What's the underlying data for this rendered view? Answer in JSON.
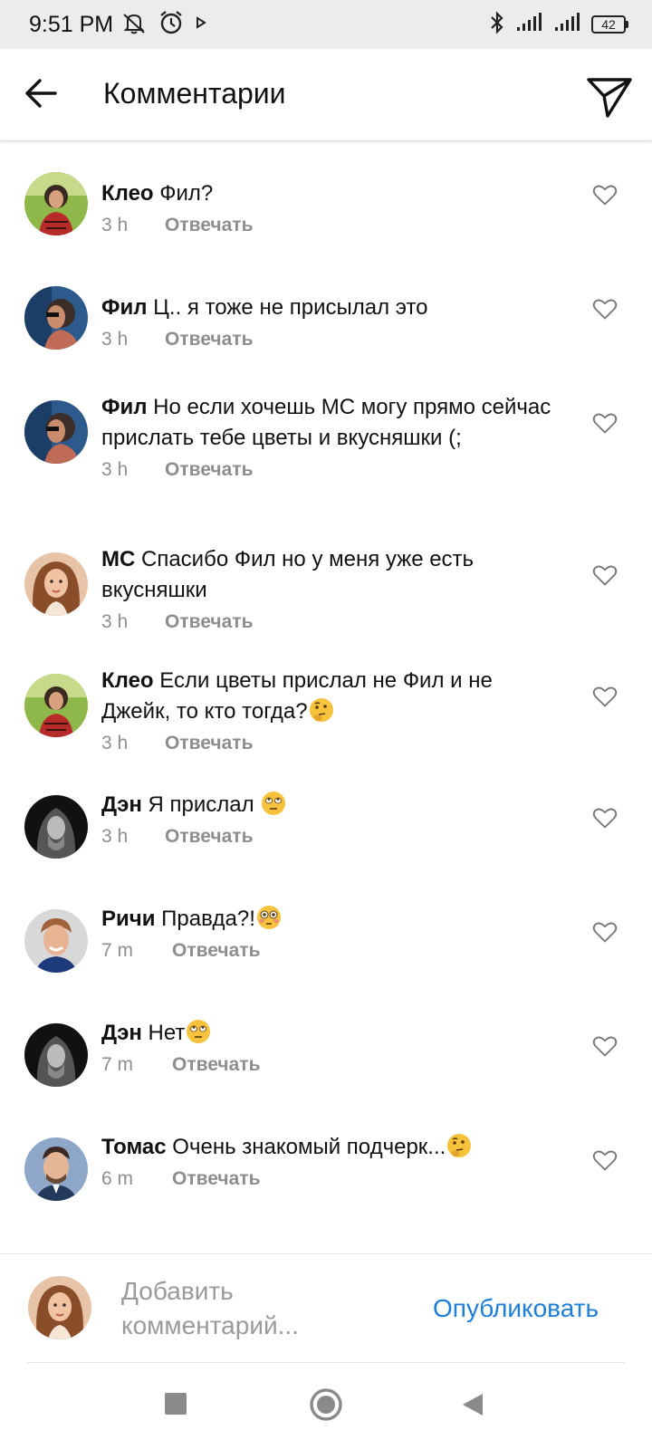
{
  "status_bar": {
    "time": "9:51 PM",
    "left_icons": [
      "mute-icon",
      "alarm-icon",
      "play-icon"
    ],
    "right_icons": [
      "bluetooth-icon",
      "signal-icon",
      "signal-icon"
    ],
    "battery": "42"
  },
  "header": {
    "title": "Комментарии",
    "back_icon": "arrow-left-icon",
    "send_icon": "paper-plane-icon"
  },
  "comments": [
    {
      "author": "Клео",
      "text": "Фил?",
      "emoji": null,
      "time": "3 h",
      "reply": "Отвечать",
      "avatar": "cleo"
    },
    {
      "author": "Фил",
      "text": "Ц.. я тоже не присылал это",
      "emoji": null,
      "time": "3 h",
      "reply": "Отвечать",
      "avatar": "phil"
    },
    {
      "author": "Фил",
      "text": "Но если хочешь МС могу прямо сейчас прислать тебе цветы и вкусняшки (;",
      "emoji": null,
      "time": "3 h",
      "reply": "Отвечать",
      "avatar": "phil"
    },
    {
      "author": "МС",
      "text": "Спасибо Фил но у меня уже есть вкусняшки",
      "emoji": null,
      "time": "3 h",
      "reply": "Отвечать",
      "avatar": "ms"
    },
    {
      "author": "Клео",
      "text": "Если цветы прислал не Фил и не Джейк, то кто тогда?",
      "emoji": "thinking-face",
      "time": "3 h",
      "reply": "Отвечать",
      "avatar": "cleo"
    },
    {
      "author": "Дэн",
      "text": "Я прислал ",
      "emoji": "eye-roll-face",
      "time": "3 h",
      "reply": "Отвечать",
      "avatar": "dan"
    },
    {
      "author": "Ричи",
      "text": "Правда?!",
      "emoji": "flushed-face",
      "time": "7 m",
      "reply": "Отвечать",
      "avatar": "richie"
    },
    {
      "author": "Дэн",
      "text": "Нет",
      "emoji": "eye-roll-face",
      "time": "7 m",
      "reply": "Отвечать",
      "avatar": "dan"
    },
    {
      "author": "Томас",
      "text": "Очень знакомый подчерк...",
      "emoji": "thinking-face",
      "time": "6 m",
      "reply": "Отвечать",
      "avatar": "thomas"
    }
  ],
  "composer": {
    "placeholder": "Добавить комментарий...",
    "publish_label": "Опубликовать"
  },
  "nav_bar": {
    "buttons": [
      "recents-square-icon",
      "home-circle-icon",
      "back-triangle-icon"
    ]
  },
  "colors": {
    "accent": "#1e7fd8",
    "meta_text": "#8e8e8e",
    "status_bar_bg": "#ececec"
  }
}
